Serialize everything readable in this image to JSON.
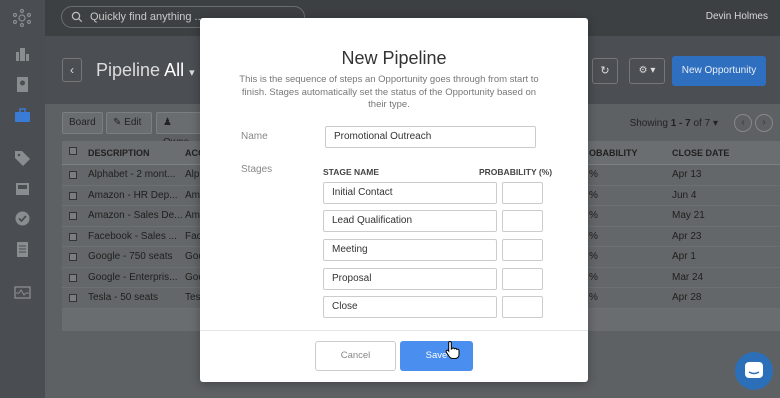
{
  "search": {
    "placeholder": "Quickly find anything ..."
  },
  "user": {
    "name": "Devin Holmes"
  },
  "header": {
    "title_prefix": "Pipeline",
    "title_value": "All",
    "new_button": "New Opportunity"
  },
  "toolbar": {
    "board": "Board",
    "edit": "Edit",
    "owner": "Owne"
  },
  "pagination": {
    "prefix": "Showing",
    "range": "1 - 7",
    "of": "of",
    "total": "7"
  },
  "table": {
    "columns": [
      "DESCRIPTION",
      "ACC",
      "OBABILITY",
      "CLOSE DATE"
    ],
    "rows": [
      {
        "description": "Alphabet - 2 mont...",
        "account": "Alp",
        "prob": "%",
        "close": "Apr 13"
      },
      {
        "description": "Amazon - HR Dep...",
        "account": "Am",
        "prob": "%",
        "close": "Jun 4"
      },
      {
        "description": "Amazon - Sales De...",
        "account": "Am",
        "prob": "%",
        "close": "May 21"
      },
      {
        "description": "Facebook - Sales ...",
        "account": "Fac",
        "prob": "%",
        "close": "Apr 23"
      },
      {
        "description": "Google - 750 seats",
        "account": "Goo",
        "prob": "%",
        "close": "Apr 1"
      },
      {
        "description": "Google - Enterpris...",
        "account": "Goo",
        "prob": "%",
        "close": "Mar 24"
      },
      {
        "description": "Tesla - 50 seats",
        "account": "Tesl",
        "prob": "%",
        "close": "Apr 28"
      }
    ]
  },
  "modal": {
    "title": "New Pipeline",
    "description": "This is the sequence of steps an Opportunity goes through from start to finish. Stages automatically set the status of the Opportunity based on their type.",
    "name_label": "Name",
    "name_value": "Promotional Outreach",
    "stages_label": "Stages",
    "stage_name_header": "STAGE NAME",
    "probability_header": "PROBABILITY (%)",
    "stages": [
      "Initial Contact",
      "Lead Qualification",
      "Meeting",
      "Proposal",
      "Close"
    ],
    "cancel": "Cancel",
    "save": "Save"
  },
  "colors": {
    "primary": "#4a8ef0",
    "new_button": "#2f6fc0",
    "sidebar": "#4a4d51"
  }
}
